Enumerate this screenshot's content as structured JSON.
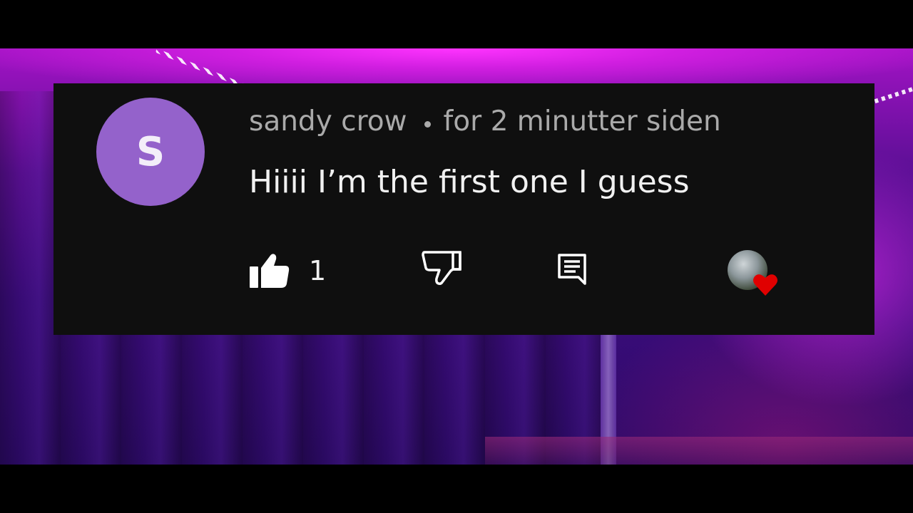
{
  "comment": {
    "author_initial": "S",
    "author_name": "sandy crow",
    "timestamp": "for 2 minutter siden",
    "text": "Hiiii I’m the first one I guess",
    "like_count": "1",
    "liked": true,
    "hearted_by_creator": true
  },
  "colors": {
    "card_background": "#0f0f0f",
    "avatar_background": "#9462cb",
    "meta_text": "#aaaaaa",
    "body_text": "#f1f1f1",
    "heart": "#e00000"
  },
  "icons": {
    "like": "thumbs-up-filled-icon",
    "dislike": "thumbs-down-outline-icon",
    "reply": "reply-comment-icon",
    "heart": "heart-icon"
  }
}
